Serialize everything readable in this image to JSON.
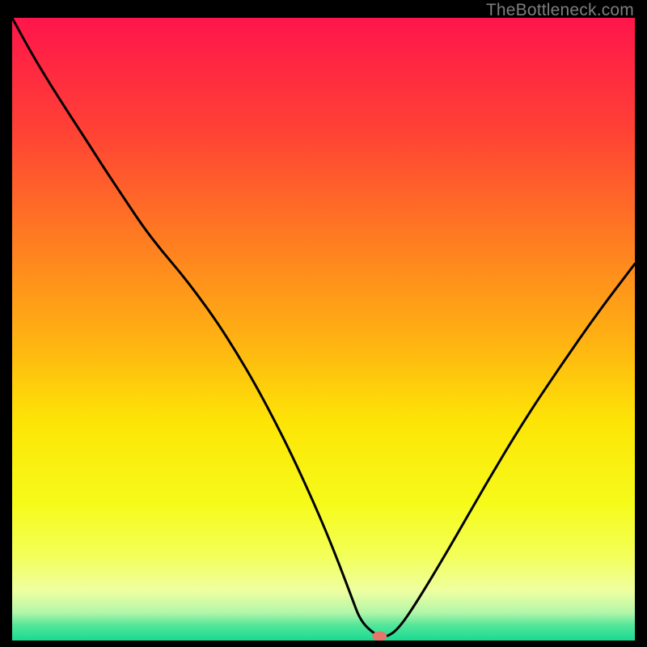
{
  "watermark": "TheBottleneck.com",
  "chart_data": {
    "type": "line",
    "title": "",
    "xlabel": "",
    "ylabel": "",
    "xlim": [
      0,
      100
    ],
    "ylim": [
      0,
      100
    ],
    "grid": false,
    "legend": false,
    "background_gradient": {
      "stops": [
        {
          "offset": 0.0,
          "color": "#ff154b"
        },
        {
          "offset": 0.18,
          "color": "#ff4135"
        },
        {
          "offset": 0.35,
          "color": "#ff7a22"
        },
        {
          "offset": 0.52,
          "color": "#ffb312"
        },
        {
          "offset": 0.65,
          "color": "#fde506"
        },
        {
          "offset": 0.78,
          "color": "#f6fb1a"
        },
        {
          "offset": 0.86,
          "color": "#f3ff55"
        },
        {
          "offset": 0.92,
          "color": "#efffa0"
        },
        {
          "offset": 0.955,
          "color": "#b4f6a9"
        },
        {
          "offset": 0.975,
          "color": "#55e69a"
        },
        {
          "offset": 1.0,
          "color": "#18db91"
        }
      ]
    },
    "series": [
      {
        "name": "bottleneck-curve",
        "color": "#000000",
        "x": [
          0.0,
          3.0,
          6.0,
          9.0,
          12.0,
          15.0,
          18.0,
          21.0,
          24.0,
          27.0,
          30.0,
          33.0,
          36.0,
          39.0,
          42.0,
          45.0,
          48.0,
          50.5,
          52.5,
          54.5,
          56.0,
          58.5,
          60.0,
          62.0,
          65.0,
          70.0,
          76.0,
          82.0,
          88.0,
          94.0,
          100.0
        ],
        "y": [
          100.0,
          94.5,
          89.5,
          84.8,
          80.2,
          75.5,
          71.0,
          66.5,
          62.6,
          59.1,
          55.2,
          51.0,
          46.3,
          41.2,
          35.6,
          29.6,
          23.1,
          17.3,
          12.3,
          7.0,
          3.0,
          0.8,
          0.5,
          1.8,
          6.2,
          14.5,
          25.0,
          35.0,
          44.0,
          52.6,
          60.5
        ]
      }
    ],
    "marker": {
      "name": "optimal-point",
      "x": 59.0,
      "y": 0.7,
      "color": "#e5766b",
      "rx": 9,
      "ry": 6
    }
  }
}
